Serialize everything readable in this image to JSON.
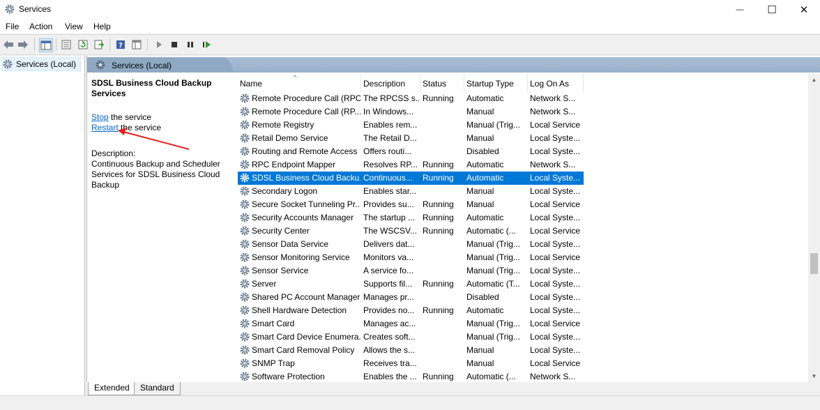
{
  "window": {
    "title": "Services",
    "minimize": "—",
    "maximize": "☐",
    "close": "✕"
  },
  "menu": [
    "File",
    "Action",
    "View",
    "Help"
  ],
  "tree": {
    "root": "Services (Local)"
  },
  "content_header": "Services (Local)",
  "desc": {
    "title": "SDSL Business Cloud Backup Services",
    "stop_link": "Stop",
    "stop_suffix": " the service",
    "restart_link": "Restart",
    "restart_suffix": " the service",
    "description_label": "Description:",
    "description_text": "Continuous Backup and Scheduler Services for SDSL Business Cloud Backup"
  },
  "columns": [
    "Name",
    "Description",
    "Status",
    "Startup Type",
    "Log On As"
  ],
  "rows": [
    {
      "name": "Remote Procedure Call (RPC)",
      "desc": "The RPCSS s...",
      "status": "Running",
      "startup": "Automatic",
      "logon": "Network S..."
    },
    {
      "name": "Remote Procedure Call (RP...",
      "desc": "In Windows...",
      "status": "",
      "startup": "Manual",
      "logon": "Network S..."
    },
    {
      "name": "Remote Registry",
      "desc": "Enables rem...",
      "status": "",
      "startup": "Manual (Trig...",
      "logon": "Local Service"
    },
    {
      "name": "Retail Demo Service",
      "desc": "The Retail D...",
      "status": "",
      "startup": "Manual",
      "logon": "Local Syste..."
    },
    {
      "name": "Routing and Remote Access",
      "desc": "Offers routi...",
      "status": "",
      "startup": "Disabled",
      "logon": "Local Syste..."
    },
    {
      "name": "RPC Endpoint Mapper",
      "desc": "Resolves RP...",
      "status": "Running",
      "startup": "Automatic",
      "logon": "Network S..."
    },
    {
      "name": "SDSL Business Cloud Backu...",
      "desc": "Continuous...",
      "status": "Running",
      "startup": "Automatic",
      "logon": "Local Syste...",
      "selected": true
    },
    {
      "name": "Secondary Logon",
      "desc": "Enables star...",
      "status": "",
      "startup": "Manual",
      "logon": "Local Syste..."
    },
    {
      "name": "Secure Socket Tunneling Pr...",
      "desc": "Provides su...",
      "status": "Running",
      "startup": "Manual",
      "logon": "Local Service"
    },
    {
      "name": "Security Accounts Manager",
      "desc": "The startup ...",
      "status": "Running",
      "startup": "Automatic",
      "logon": "Local Syste..."
    },
    {
      "name": "Security Center",
      "desc": "The WSCSV...",
      "status": "Running",
      "startup": "Automatic (...",
      "logon": "Local Service"
    },
    {
      "name": "Sensor Data Service",
      "desc": "Delivers dat...",
      "status": "",
      "startup": "Manual (Trig...",
      "logon": "Local Syste..."
    },
    {
      "name": "Sensor Monitoring Service",
      "desc": "Monitors va...",
      "status": "",
      "startup": "Manual (Trig...",
      "logon": "Local Service"
    },
    {
      "name": "Sensor Service",
      "desc": "A service fo...",
      "status": "",
      "startup": "Manual (Trig...",
      "logon": "Local Syste..."
    },
    {
      "name": "Server",
      "desc": "Supports fil...",
      "status": "Running",
      "startup": "Automatic (T...",
      "logon": "Local Syste..."
    },
    {
      "name": "Shared PC Account Manager",
      "desc": "Manages pr...",
      "status": "",
      "startup": "Disabled",
      "logon": "Local Syste..."
    },
    {
      "name": "Shell Hardware Detection",
      "desc": "Provides no...",
      "status": "Running",
      "startup": "Automatic",
      "logon": "Local Syste..."
    },
    {
      "name": "Smart Card",
      "desc": "Manages ac...",
      "status": "",
      "startup": "Manual (Trig...",
      "logon": "Local Service"
    },
    {
      "name": "Smart Card Device Enumera...",
      "desc": "Creates soft...",
      "status": "",
      "startup": "Manual (Trig...",
      "logon": "Local Syste..."
    },
    {
      "name": "Smart Card Removal Policy",
      "desc": "Allows the s...",
      "status": "",
      "startup": "Manual",
      "logon": "Local Syste..."
    },
    {
      "name": "SNMP Trap",
      "desc": "Receives tra...",
      "status": "",
      "startup": "Manual",
      "logon": "Local Service"
    },
    {
      "name": "Software Protection",
      "desc": "Enables the ...",
      "status": "Running",
      "startup": "Automatic (...",
      "logon": "Network S..."
    }
  ],
  "tabs": [
    "Extended",
    "Standard"
  ],
  "toolbar_icons": [
    "back-arrow-icon",
    "forward-arrow-icon",
    "console-tree-icon",
    "properties-icon",
    "refresh-icon",
    "export-list-icon",
    "help-icon",
    "view-icon",
    "play-icon",
    "stop-icon",
    "pause-icon",
    "resume-icon"
  ],
  "colors": {
    "selection": "#0078d7",
    "link": "#0066cc",
    "annotation_arrow": "#e02020"
  }
}
